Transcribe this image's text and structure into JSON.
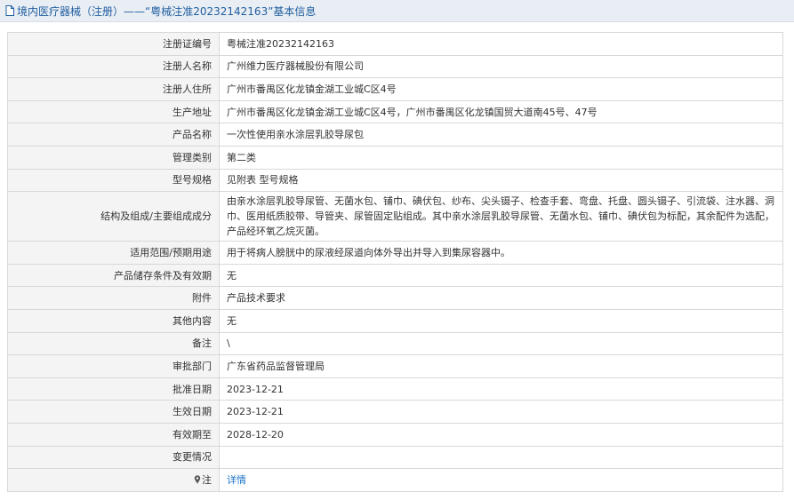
{
  "header": {
    "title": "境内医疗器械（注册）——“粤械注准20232142163”基本信息"
  },
  "rows": [
    {
      "label": "注册证编号",
      "value": "粤械注准20232142163"
    },
    {
      "label": "注册人名称",
      "value": "广州维力医疗器械股份有限公司"
    },
    {
      "label": "注册人住所",
      "value": "广州市番禺区化龙镇金湖工业城C区4号"
    },
    {
      "label": "生产地址",
      "value": "广州市番禺区化龙镇金湖工业城C区4号，广州市番禺区化龙镇国贸大道南45号、47号"
    },
    {
      "label": "产品名称",
      "value": "一次性使用亲水涂层乳胶导尿包"
    },
    {
      "label": "管理类别",
      "value": "第二类"
    },
    {
      "label": "型号规格",
      "value": "见附表 型号规格"
    },
    {
      "label": "结构及组成/主要组成成分",
      "value": "由亲水涂层乳胶导尿管、无菌水包、铺巾、碘伏包、纱布、尖头镊子、检查手套、弯盘、托盘、圆头镊子、引流袋、注水器、洞巾、医用纸质胶带、导管夹、尿管固定贴组成。其中亲水涂层乳胶导尿管、无菌水包、铺巾、碘伏包为标配，其余配件为选配，产品经环氧乙烷灭菌。"
    },
    {
      "label": "适用范围/预期用途",
      "value": "用于将病人膀胱中的尿液经尿道向体外导出并导入到集尿容器中。"
    },
    {
      "label": "产品储存条件及有效期",
      "value": "无"
    },
    {
      "label": "附件",
      "value": "产品技术要求"
    },
    {
      "label": "其他内容",
      "value": "无"
    },
    {
      "label": "备注",
      "value": "\\"
    },
    {
      "label": "审批部门",
      "value": "广东省药品监督管理局"
    },
    {
      "label": "批准日期",
      "value": "2023-12-21"
    },
    {
      "label": "生效日期",
      "value": "2023-12-21"
    },
    {
      "label": "有效期至",
      "value": "2028-12-20"
    },
    {
      "label": "变更情况",
      "value": ""
    }
  ],
  "note": {
    "label": "注",
    "link_text": "详情",
    "icon": "pin-icon"
  },
  "colors": {
    "header_text": "#1f5d9f",
    "link": "#1a73c7",
    "label_bg": "#f4f4f4",
    "border": "#d8d8d8"
  }
}
